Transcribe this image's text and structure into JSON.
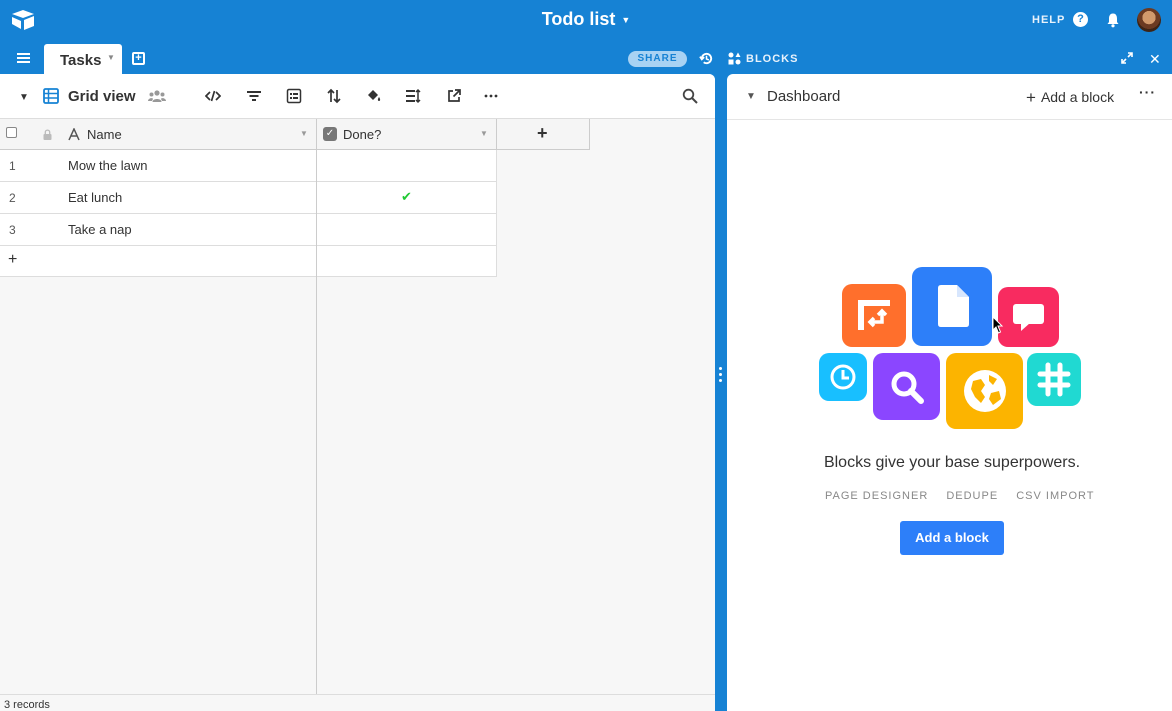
{
  "header": {
    "title": "Todo list",
    "help_label": "HELP",
    "help_icon_glyph": "?"
  },
  "tabbar": {
    "tab_label": "Tasks",
    "share_label": "SHARE",
    "blocks_label": "BLOCKS",
    "close_glyph": "✕"
  },
  "view": {
    "name": "Grid view"
  },
  "table": {
    "columns": [
      {
        "label": "Name",
        "type": "text"
      },
      {
        "label": "Done?",
        "type": "checkbox"
      }
    ],
    "add_field_glyph": "+",
    "rows": [
      {
        "num": "1",
        "name": "Mow the lawn",
        "done": false
      },
      {
        "num": "2",
        "name": "Eat lunch",
        "done": true
      },
      {
        "num": "3",
        "name": "Take a nap",
        "done": false
      }
    ],
    "add_row_glyph": "+",
    "checkmark_glyph": "✔",
    "footer": "3 records"
  },
  "dashboard": {
    "title": "Dashboard",
    "add_block_label": "Add a block",
    "more_glyph": "···",
    "tagline": "Blocks give your base superpowers.",
    "features": [
      "PAGE DESIGNER",
      "DEDUPE",
      "CSV IMPORT"
    ],
    "cta_label": "Add a block"
  },
  "colors": {
    "brand_blue": "#1682d4",
    "cta_blue": "#2d7ff9",
    "check_green": "#20c933",
    "tile_orange": "#ff6f2c",
    "tile_blue": "#2d7ff9",
    "tile_pink": "#f82b60",
    "tile_cyan": "#18bfff",
    "tile_purple": "#8b46ff",
    "tile_yellow": "#fcb400",
    "tile_teal": "#20d9d2"
  },
  "icons": [
    "logo-icon",
    "help-icon",
    "bell-icon",
    "avatar",
    "menu-icon",
    "add-table-icon",
    "history-icon",
    "blocks-icon",
    "expand-icon",
    "close-icon",
    "grid-view-icon",
    "people-icon",
    "hide-fields-icon",
    "filter-icon",
    "group-icon",
    "sort-icon",
    "color-icon",
    "row-height-icon",
    "share-view-icon",
    "more-icon",
    "search-icon"
  ]
}
